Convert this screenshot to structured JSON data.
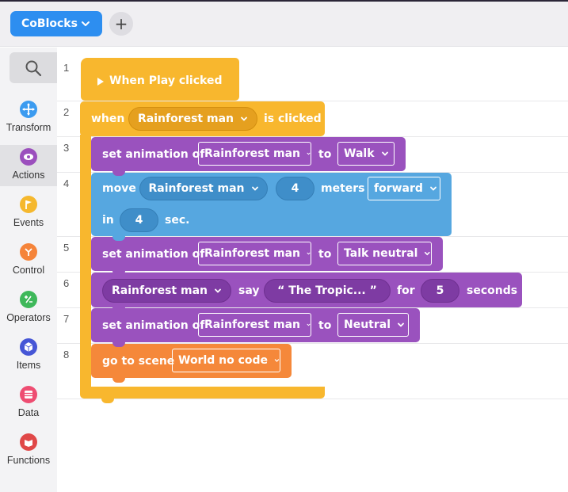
{
  "header": {
    "project_name": "CoBlocks",
    "add_label": "+"
  },
  "sidebar": {
    "categories": [
      {
        "label": "Transform",
        "color": "#3b9bf0",
        "icon": "move-icon",
        "active": false
      },
      {
        "label": "Actions",
        "color": "#9b4fbd",
        "icon": "eye-icon",
        "active": true
      },
      {
        "label": "Events",
        "color": "#f5b82e",
        "icon": "flag-icon",
        "active": false
      },
      {
        "label": "Control",
        "color": "#f5843a",
        "icon": "branch-icon",
        "active": false
      },
      {
        "label": "Operators",
        "color": "#3eb85a",
        "icon": "plus-minus-icon",
        "active": false
      },
      {
        "label": "Items",
        "color": "#4656d6",
        "icon": "cube-icon",
        "active": false
      },
      {
        "label": "Data",
        "color": "#ee4d72",
        "icon": "list-icon",
        "active": false
      },
      {
        "label": "Functions",
        "color": "#e04848",
        "icon": "function-icon",
        "active": false
      }
    ]
  },
  "colors": {
    "events": "#f8b72e",
    "actions": "#9a52be",
    "transform": "#56a7e0",
    "control": "#f5883a"
  },
  "code": {
    "line_numbers": [
      "1",
      "2",
      "3",
      "4",
      "5",
      "6",
      "7",
      "8"
    ],
    "play_block": "When Play clicked",
    "when_block": {
      "when": "when",
      "object": "Rainforest man",
      "is_clicked": "is clicked"
    },
    "anim1": {
      "label": "set animation of",
      "object": "Rainforest man",
      "to": "to",
      "anim": "Walk"
    },
    "move": {
      "label": "move",
      "object": "Rainforest man",
      "amount": "4",
      "unit": "meters",
      "direction": "forward",
      "in": "in",
      "time": "4",
      "sec": "sec."
    },
    "anim2": {
      "label": "set animation of",
      "object": "Rainforest man",
      "to": "to",
      "anim": "Talk neutral"
    },
    "say": {
      "object": "Rainforest man",
      "say": "say",
      "text": "“ The Tropic... ”",
      "for": "for",
      "seconds_value": "5",
      "seconds": "seconds"
    },
    "anim3": {
      "label": "set animation of",
      "object": "Rainforest man",
      "to": "to",
      "anim": "Neutral"
    },
    "scene": {
      "label": "go to scene",
      "scene": "World no code"
    }
  }
}
